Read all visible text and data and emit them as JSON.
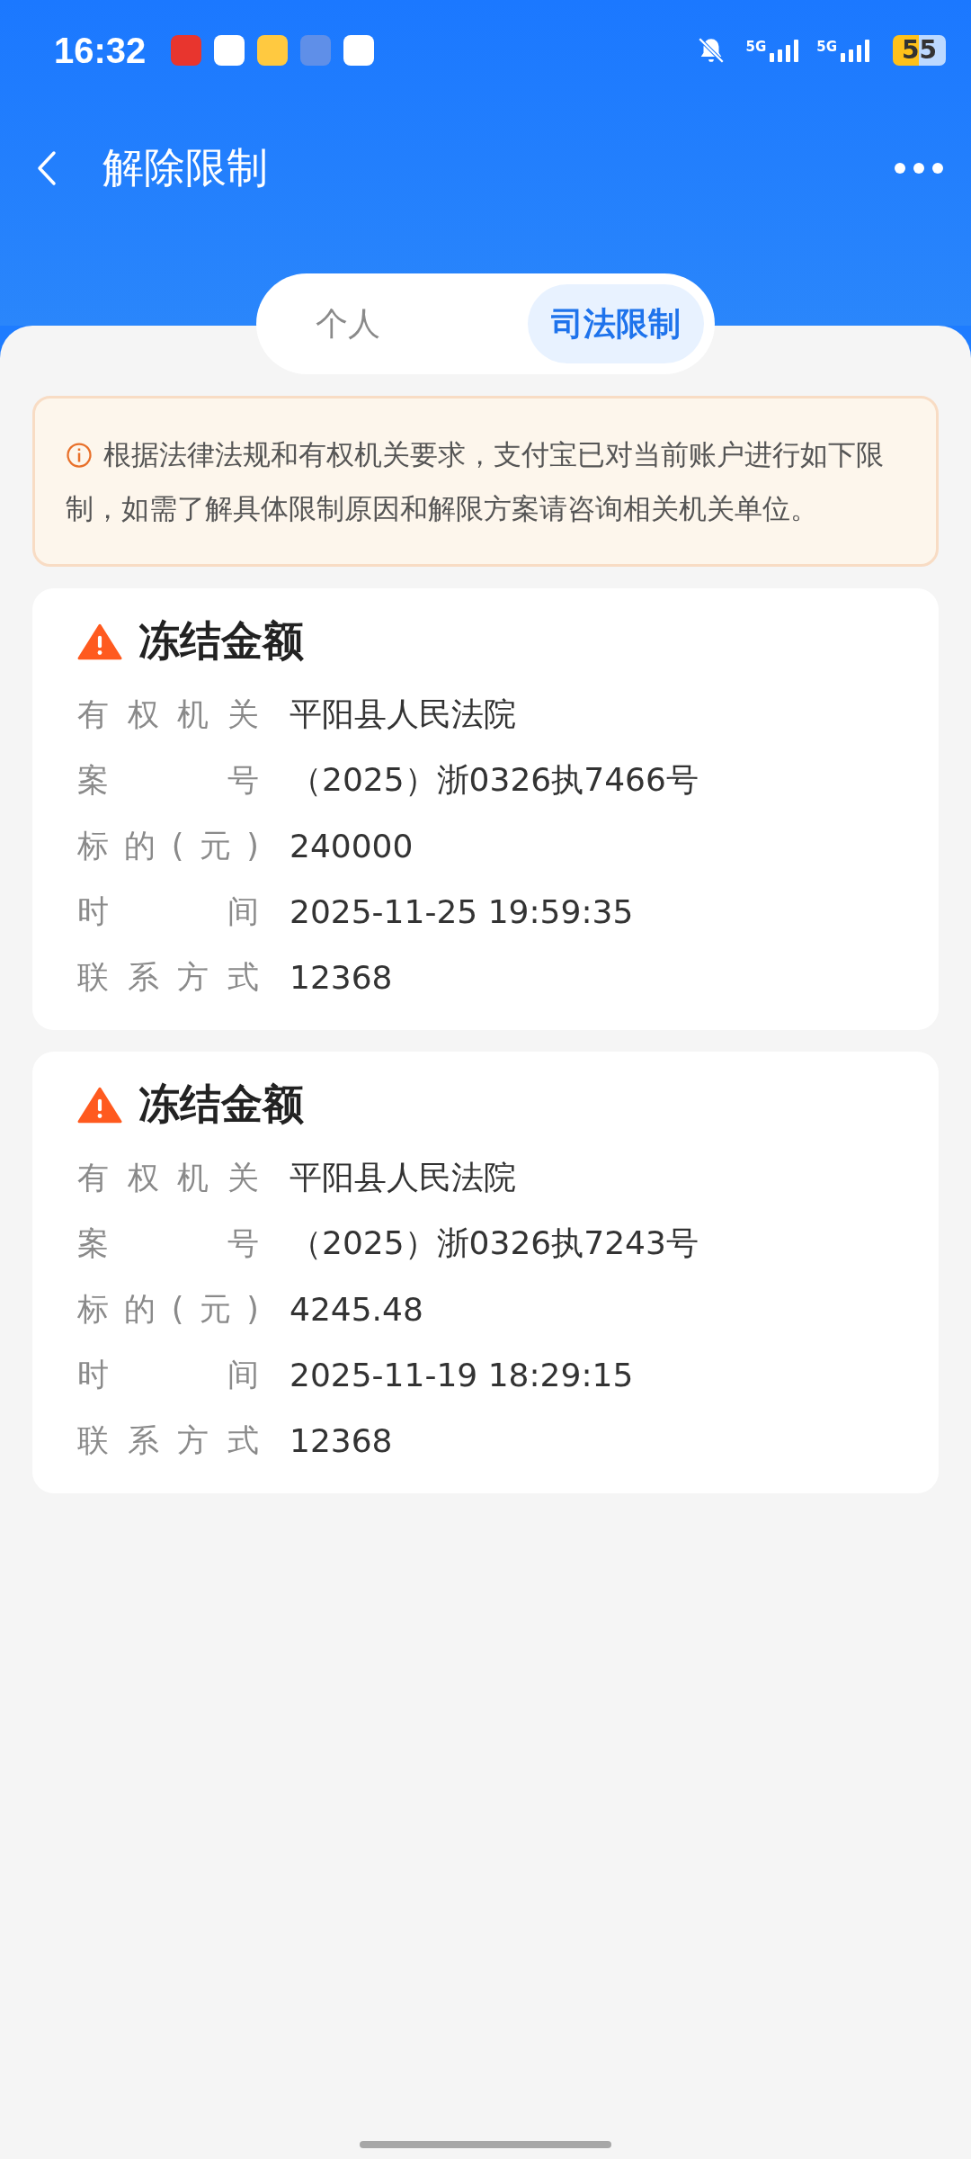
{
  "status_bar": {
    "time": "16:32",
    "battery": "55",
    "network": [
      "5G",
      "5G"
    ]
  },
  "header": {
    "title": "解除限制"
  },
  "tabs": [
    {
      "label": "个人",
      "selected": false
    },
    {
      "label": "司法限制",
      "selected": true
    }
  ],
  "notice": {
    "text": "根据法律法规和有权机关要求，支付宝已对当前账户进行如下限制，如需了解具体限制原因和解限方案请咨询相关机关单位。"
  },
  "cards": [
    {
      "title": "冻结金额",
      "rows": [
        {
          "label": "有权机关",
          "value": "平阳县人民法院"
        },
        {
          "label": "案号",
          "value": "（2025）浙0326执7466号"
        },
        {
          "label": "标的(元)",
          "value": "240000"
        },
        {
          "label": "时间",
          "value": "2025-11-25 19:59:35"
        },
        {
          "label": "联系方式",
          "value": "12368"
        }
      ]
    },
    {
      "title": "冻结金额",
      "rows": [
        {
          "label": "有权机关",
          "value": "平阳县人民法院"
        },
        {
          "label": "案号",
          "value": "（2025）浙0326执7243号"
        },
        {
          "label": "标的(元)",
          "value": "4245.48"
        },
        {
          "label": "时间",
          "value": "2025-11-19 18:29:15"
        },
        {
          "label": "联系方式",
          "value": "12368"
        }
      ]
    }
  ]
}
